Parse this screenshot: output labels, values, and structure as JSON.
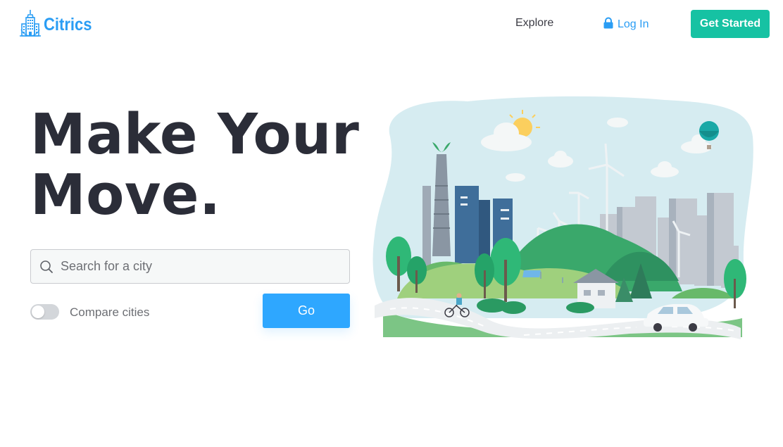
{
  "nav": {
    "logo_text": "Citrics",
    "explore_label": "Explore",
    "login_label": "Log In",
    "get_started_label": "Get Started"
  },
  "hero": {
    "title_line1": "Make Your",
    "title_line2": "Move."
  },
  "search": {
    "placeholder": "Search for a city",
    "value": ""
  },
  "compare": {
    "label": "Compare cities",
    "enabled": false
  },
  "go_label": "Go",
  "colors": {
    "brand": "#2a9df4",
    "accent_green": "#16c2a3",
    "go_blue": "#2ea7ff",
    "title": "#2b2d38"
  },
  "icons": {
    "logo": "city-building-icon",
    "login": "lock-icon",
    "search": "search-icon"
  }
}
